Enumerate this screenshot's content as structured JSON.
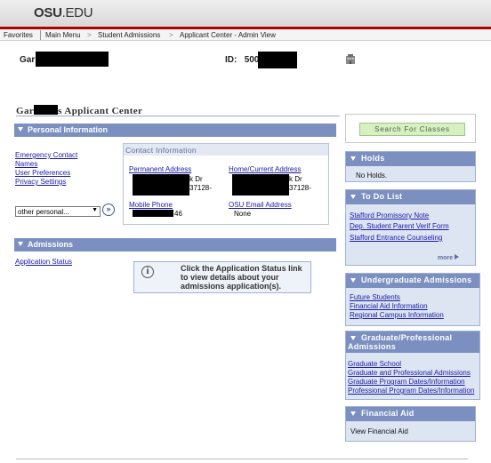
{
  "site": {
    "logo_main": "OSU",
    "logo_tld": ".EDU"
  },
  "nav": {
    "favorites": "Favorites",
    "main_menu": "Main Menu",
    "sep": ">",
    "crumb1": "Student Admissions",
    "crumb2": "Applicant Center - Admin View"
  },
  "header": {
    "name_prefix": "Gar",
    "id_label": "ID:",
    "id_prefix": "500"
  },
  "page": {
    "title_prefix": "Gar",
    "title_suffix": "s Applicant Center"
  },
  "personal": {
    "header": "Personal Information",
    "links": [
      "Emergency Contact",
      "Names",
      "User Preferences",
      "Privacy Settings"
    ],
    "select_value": "other personal...",
    "select_arrow": "▼",
    "go": "»"
  },
  "contact": {
    "title": "Contact Information",
    "permanent_label": "Permanent Address",
    "permanent_line1": "k Dr",
    "permanent_line2": "37128-",
    "home_label": "Home/Current Address",
    "home_line1": "k Dr",
    "home_line2": "37128-",
    "mobile_label": "Mobile Phone",
    "mobile_value": "46",
    "email_label": "OSU Email Address",
    "email_value": "None"
  },
  "admissions": {
    "header": "Admissions",
    "status_link": "Application Status",
    "info_icon": "i",
    "info_text": "Click the Application Status link to view details about your admissions application(s)."
  },
  "search": {
    "button": "Search For Classes"
  },
  "holds": {
    "header": "Holds",
    "text": "No Holds."
  },
  "todo": {
    "header": "To Do List",
    "items": [
      "Stafford Promissory Note",
      "Dep. Student Parent Verif Form",
      "Stafford Entrance Counseling"
    ],
    "more": "more"
  },
  "undergrad": {
    "header": "Undergraduate Admissions",
    "links": [
      "Future Students",
      "Financial Aid Information",
      "Regional Campus Information"
    ]
  },
  "grad": {
    "header_line1": "Graduate/Professional",
    "header_line2": "Admissions",
    "links": [
      "Graduate School",
      "Graduate and Professional Admissions",
      "Graduate Program Dates/Information",
      "Professional Program Dates/Information"
    ]
  },
  "finaid": {
    "header": "Financial Aid",
    "text": "View Financial Aid"
  },
  "colors": {
    "accent_red": "#b00000",
    "section_header": "#7b8fc0",
    "panel_bg": "#dde5f2",
    "link": "#1a1aa6",
    "search_btn": "#d6f0c2"
  }
}
